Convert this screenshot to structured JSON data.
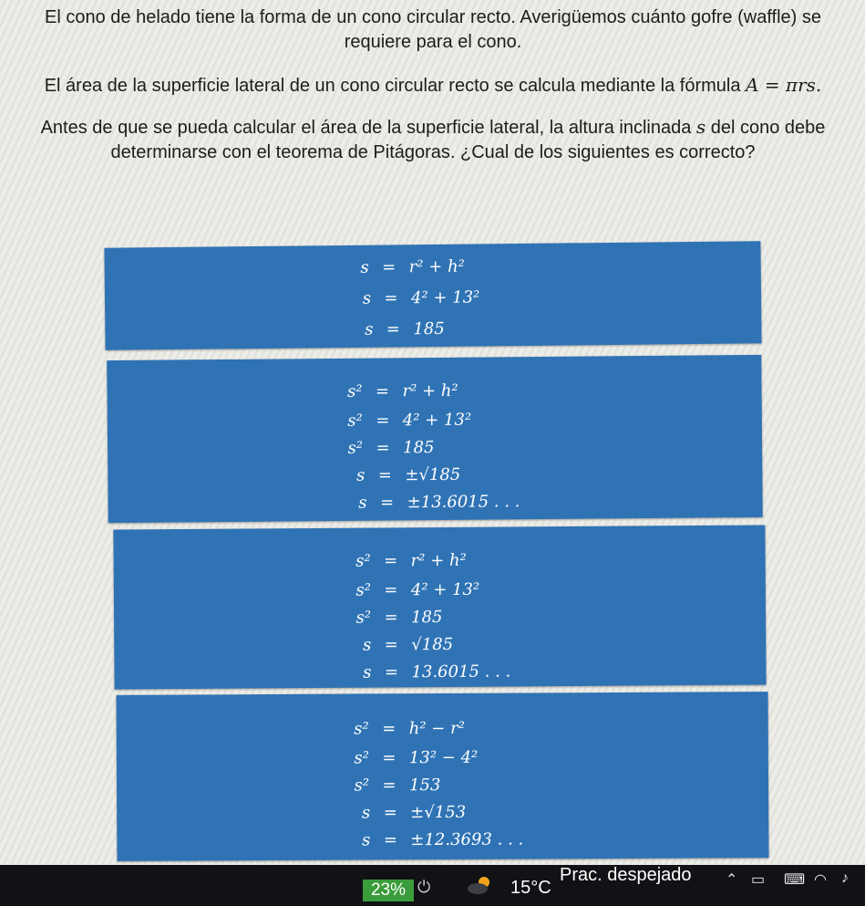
{
  "question": {
    "p1": "El cono de helado tiene la forma de un cono circular recto. Averigüemos cuánto gofre (waffle) se requiere para el cono.",
    "p2_text": "El área de la superficie lateral de un cono circular recto se calcula mediante la fórmula",
    "p2_formula": "A = πrs.",
    "p3_a": "Antes de que se pueda calcular el área de la superficie lateral, la altura inclinada",
    "p3_var": "s",
    "p3_b": "del cono debe determinarse con el teorema de Pitágoras. ¿Cual de los siguientes es correcto?"
  },
  "options": [
    {
      "lines": [
        {
          "lhs": "s",
          "rhs": "r² + h²"
        },
        {
          "lhs": "s",
          "rhs": "4² + 13²"
        },
        {
          "lhs": "s",
          "rhs": "185"
        }
      ]
    },
    {
      "lines": [
        {
          "lhs": "s²",
          "rhs": "r² + h²"
        },
        {
          "lhs": "s²",
          "rhs": "4² + 13²"
        },
        {
          "lhs": "s²",
          "rhs": "185"
        },
        {
          "lhs": "s",
          "rhs": "±√185"
        },
        {
          "lhs": "s",
          "rhs": "±13.6015 . . ."
        }
      ]
    },
    {
      "lines": [
        {
          "lhs": "s²",
          "rhs": "r² + h²"
        },
        {
          "lhs": "s²",
          "rhs": "4² + 13²"
        },
        {
          "lhs": "s²",
          "rhs": "185"
        },
        {
          "lhs": "s",
          "rhs": "√185"
        },
        {
          "lhs": "s",
          "rhs": "13.6015 . . ."
        }
      ]
    },
    {
      "lines": [
        {
          "lhs": "s²",
          "rhs": "h² − r²"
        },
        {
          "lhs": "s²",
          "rhs": "13² − 4²"
        },
        {
          "lhs": "s²",
          "rhs": "153"
        },
        {
          "lhs": "s",
          "rhs": "±√153"
        },
        {
          "lhs": "s",
          "rhs": "±12.3693 . . ."
        }
      ]
    }
  ],
  "equals": "=",
  "taskbar": {
    "battery": "23%",
    "temperature": "15°C",
    "condition": "Prac. despejado",
    "icons": [
      "plug-icon",
      "weather-cloud-sun-icon",
      "chevron-up-icon",
      "monitor-icon",
      "keyboard-icon",
      "wifi-icon",
      "speaker-icon"
    ]
  },
  "colors": {
    "option_bg": "#2f73b5",
    "battery_bg": "#3a9c3a",
    "taskbar_bg": "#101216"
  }
}
